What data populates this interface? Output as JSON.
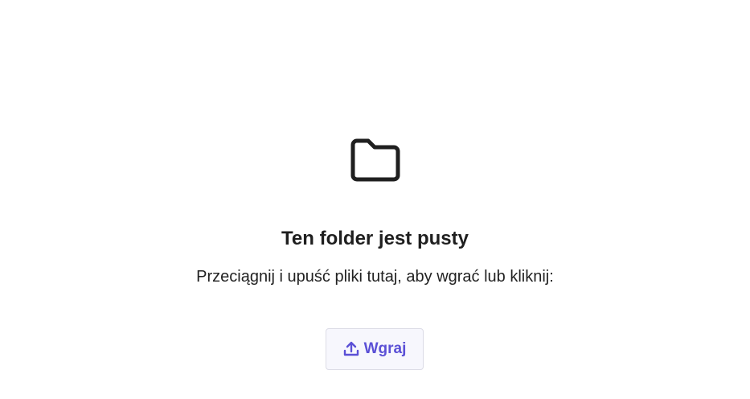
{
  "empty_state": {
    "icon": "folder-icon",
    "title": "Ten folder jest pusty",
    "subtitle": "Przeciągnij i upuść pliki tutaj, aby wgrać lub kliknij:"
  },
  "upload_button": {
    "icon": "upload-icon",
    "label": "Wgraj"
  },
  "colors": {
    "accent": "#5b50d6",
    "button_bg": "#f7f7fd",
    "button_border": "#dcdce6",
    "text": "#1f1f1f"
  }
}
